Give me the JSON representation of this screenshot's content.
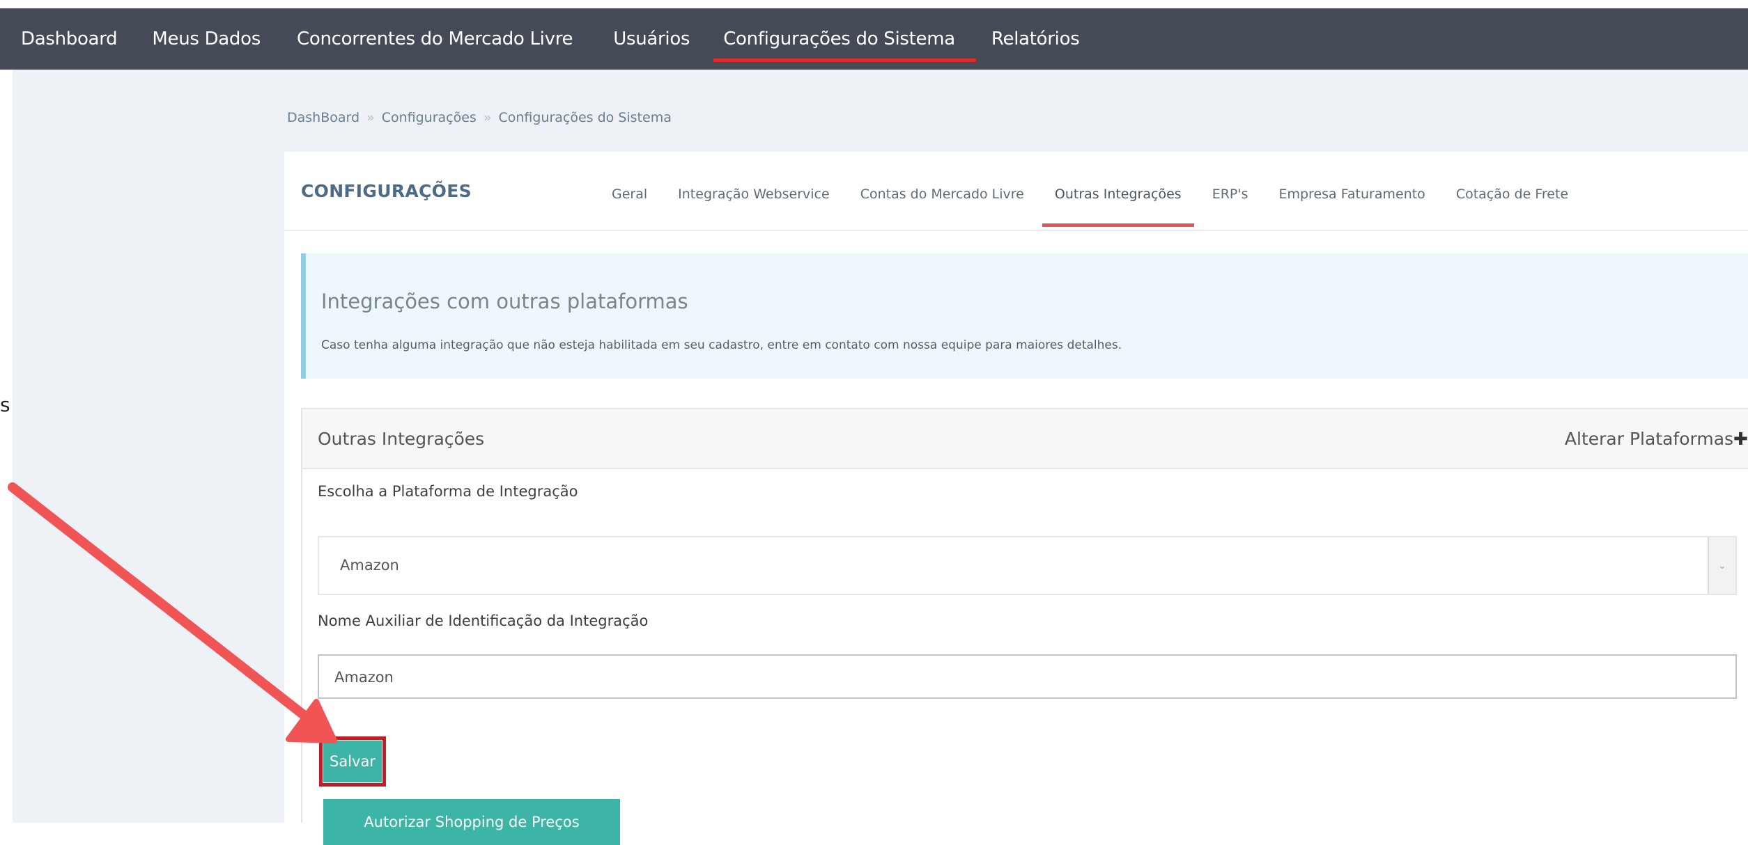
{
  "nav": {
    "items": [
      {
        "label": "Dashboard"
      },
      {
        "label": "Meus Dados"
      },
      {
        "label": "Concorrentes do Mercado Livre"
      },
      {
        "label": "Usuários"
      },
      {
        "label": "Configurações do Sistema",
        "active": true
      },
      {
        "label": "Relatórios"
      }
    ]
  },
  "breadcrumb": {
    "items": [
      "DashBoard",
      "Configurações",
      "Configurações do Sistema"
    ],
    "separator": "»"
  },
  "card": {
    "title": "CONFIGURAÇÕES",
    "tabs": [
      {
        "label": "Geral"
      },
      {
        "label": "Integração Webservice"
      },
      {
        "label": "Contas do Mercado Livre"
      },
      {
        "label": "Outras Integrações",
        "active": true
      },
      {
        "label": "ERP's"
      },
      {
        "label": "Empresa Faturamento"
      },
      {
        "label": "Cotação de Frete"
      }
    ]
  },
  "note": {
    "title": "Integrações com outras plataformas",
    "text": "Caso tenha alguma integração que não esteja habilitada em seu cadastro, entre em contato com nossa equipe para maiores detalhes."
  },
  "panel": {
    "title": "Outras Integrações",
    "action_label": "Alterar Plataformas",
    "action_icon": "plus-icon",
    "platform_label": "Escolha a Plataforma de Integração",
    "platform_value": "Amazon",
    "name_label": "Nome Auxiliar de Identificação da Integração",
    "name_value": "Amazon"
  },
  "buttons": {
    "save_label": "Salvar",
    "authorize_label": "Autorizar Shopping de Preços"
  },
  "left_edge_glyph": "s",
  "colors": {
    "navbar": "#444b56",
    "active_underline": "#e02a2a",
    "tab_underline": "#e0545c",
    "button": "#3cb4a6",
    "highlight": "#c21c24",
    "arrow": "#f05454"
  }
}
